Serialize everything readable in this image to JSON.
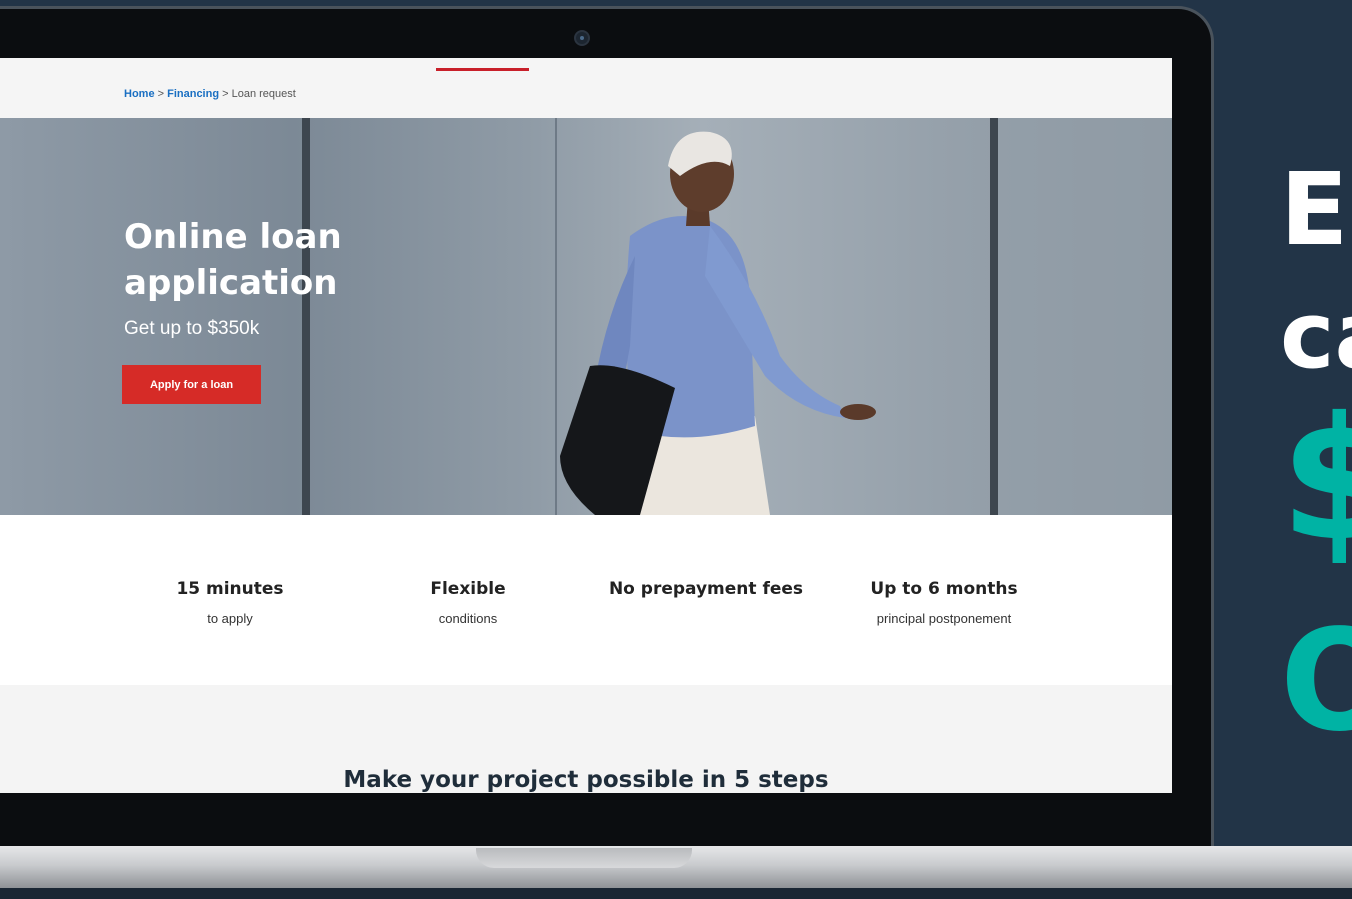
{
  "side_text": {
    "line1": "E",
    "line2": "ca",
    "line3": "$",
    "line4": "O"
  },
  "breadcrumb": {
    "home": "Home",
    "sep1": " > ",
    "financing": "Financing",
    "sep2": " > ",
    "current": "Loan request"
  },
  "hero": {
    "title": "Online loan application",
    "subtitle": "Get up to $350k",
    "cta_label": "Apply for a loan"
  },
  "features": [
    {
      "title": "15 minutes",
      "subtitle": "to apply"
    },
    {
      "title": "Flexible",
      "subtitle": "conditions"
    },
    {
      "title": "No prepayment fees",
      "subtitle": ""
    },
    {
      "title": "Up to  6 months",
      "subtitle": "principal postponement"
    }
  ],
  "steps": {
    "title": "Make your project possible in 5 steps"
  },
  "colors": {
    "background": "#223447",
    "accent_teal": "#00b3a4",
    "cta_red": "#d62b27",
    "link_blue": "#1a6fc2"
  }
}
